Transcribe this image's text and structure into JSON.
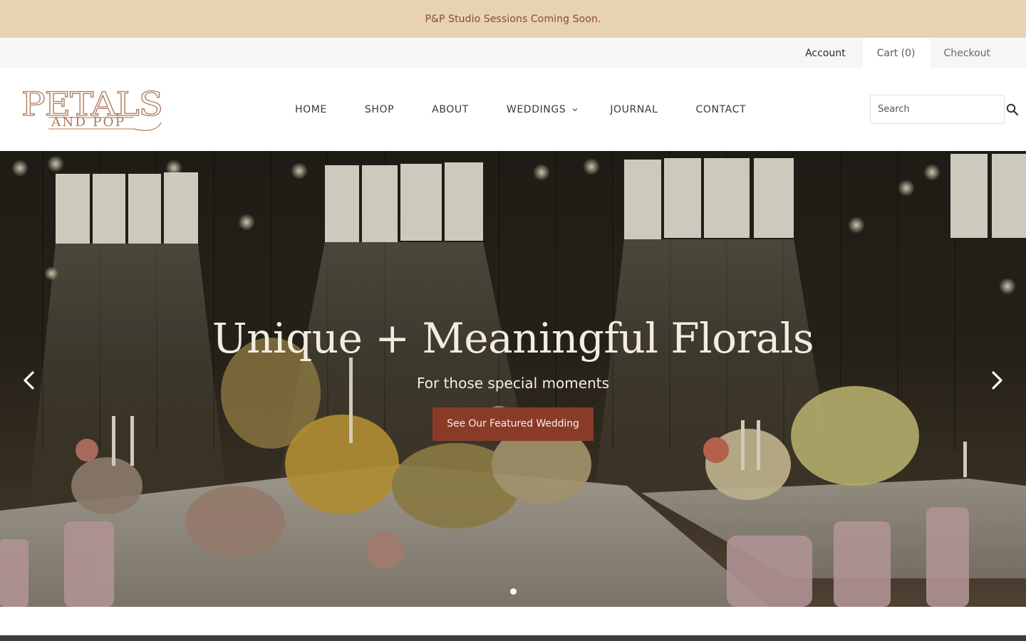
{
  "announcement": {
    "text": "P&P Studio Sessions Coming Soon."
  },
  "utility": {
    "account_label": "Account",
    "cart_label": "Cart (0)",
    "checkout_label": "Checkout"
  },
  "logo": {
    "line1": "PETALS",
    "line2": "AND POP"
  },
  "nav": {
    "items": [
      {
        "label": "HOME"
      },
      {
        "label": "SHOP"
      },
      {
        "label": "ABOUT"
      },
      {
        "label": "WEDDINGS"
      },
      {
        "label": "JOURNAL"
      },
      {
        "label": "CONTACT"
      }
    ]
  },
  "search": {
    "placeholder": "Search",
    "value": ""
  },
  "hero": {
    "title": "Unique + Meaningful Florals",
    "subtitle": "For those special moments",
    "cta_label": "See Our Featured Wedding",
    "slide_count": 2,
    "active_slide": 1
  },
  "colors": {
    "announcement_bg": "#e8d2b4",
    "announcement_text": "#8a4a35",
    "brand": "#8a3b28",
    "logo": "#b07a5a"
  },
  "icons": {
    "search": "search-icon",
    "weddings_dropdown": "chevron-down-icon",
    "prev": "chevron-left-icon",
    "next": "chevron-right-icon"
  }
}
